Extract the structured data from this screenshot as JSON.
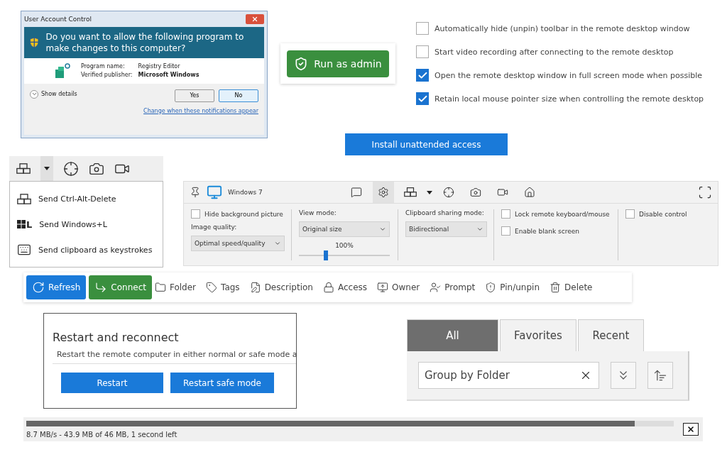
{
  "uac": {
    "title": "User Account Control",
    "question": "Do you want to allow the following program to make changes to this computer?",
    "fields": [
      {
        "label": "Program name:",
        "value": "Registry Editor",
        "bold": false
      },
      {
        "label": "Verified publisher:",
        "value": "Microsoft Windows",
        "bold": true
      }
    ],
    "details": "Show details",
    "buttons": [
      {
        "label": "Yes",
        "selected": false
      },
      {
        "label": "No",
        "selected": true
      }
    ],
    "link": "Change when these notifications appear"
  },
  "admin_button": "Run as admin",
  "options": [
    {
      "label": "Automatically hide (unpin) toolbar in the remote desktop window",
      "checked": false
    },
    {
      "label": "Start video recording after connecting to the remote desktop",
      "checked": false
    },
    {
      "label": "Open the remote desktop window in full screen mode when possible",
      "checked": true
    },
    {
      "label": "Retain local mouse pointer size when controlling the remote desktop",
      "checked": true
    }
  ],
  "install_button": "Install unattended access",
  "send_menu": {
    "items": [
      {
        "kind": "cad",
        "label": "Send Ctrl-Alt-Delete"
      },
      {
        "kind": "winkey",
        "key": "L",
        "label": "Send Windows+L"
      },
      {
        "kind": "keyboard",
        "label": "Send clipboard as keystrokes"
      }
    ]
  },
  "remote_toolbar": {
    "title": "Windows 7",
    "hide_background": {
      "label": "Hide background picture",
      "checked": false
    },
    "image_quality": {
      "label": "Image quality:",
      "value": "Optimal speed/quality"
    },
    "view_mode": {
      "label": "View mode:",
      "value": "Original size",
      "zoom": "100%",
      "level": 0.3
    },
    "clipboard": {
      "label": "Clipboard sharing mode:",
      "value": "Bidirectional"
    },
    "toggles": [
      {
        "label": "Lock remote keyboard/mouse",
        "checked": false
      },
      {
        "label": "Enable blank screen",
        "checked": false
      }
    ],
    "disable_control": {
      "label": "Disable control",
      "checked": false
    }
  },
  "actions": [
    {
      "kind": "primary",
      "label": "Refresh"
    },
    {
      "kind": "success",
      "label": "Connect"
    },
    {
      "kind": "plain",
      "label": "Folder"
    },
    {
      "kind": "plain",
      "label": "Tags"
    },
    {
      "kind": "plain",
      "label": "Description"
    },
    {
      "kind": "plain",
      "label": "Access"
    },
    {
      "kind": "plain",
      "label": "Owner"
    },
    {
      "kind": "plain",
      "label": "Prompt"
    },
    {
      "kind": "plain",
      "label": "Pin/unpin"
    },
    {
      "kind": "plain",
      "label": "Delete"
    }
  ],
  "restart": {
    "title": "Restart and reconnect",
    "description": "Restart the remote computer in either normal or safe mode a",
    "buttons": [
      "Restart",
      "Restart safe mode"
    ]
  },
  "filter_tabs": [
    {
      "label": "All",
      "selected": true
    },
    {
      "label": "Favorites",
      "selected": false
    },
    {
      "label": "Recent",
      "selected": false
    }
  ],
  "group_field": {
    "value": "Group by Folder"
  },
  "download": {
    "status": "8.7 MB/s -  43.9 MB of 46 MB, 1 second left",
    "level": 0.94
  }
}
